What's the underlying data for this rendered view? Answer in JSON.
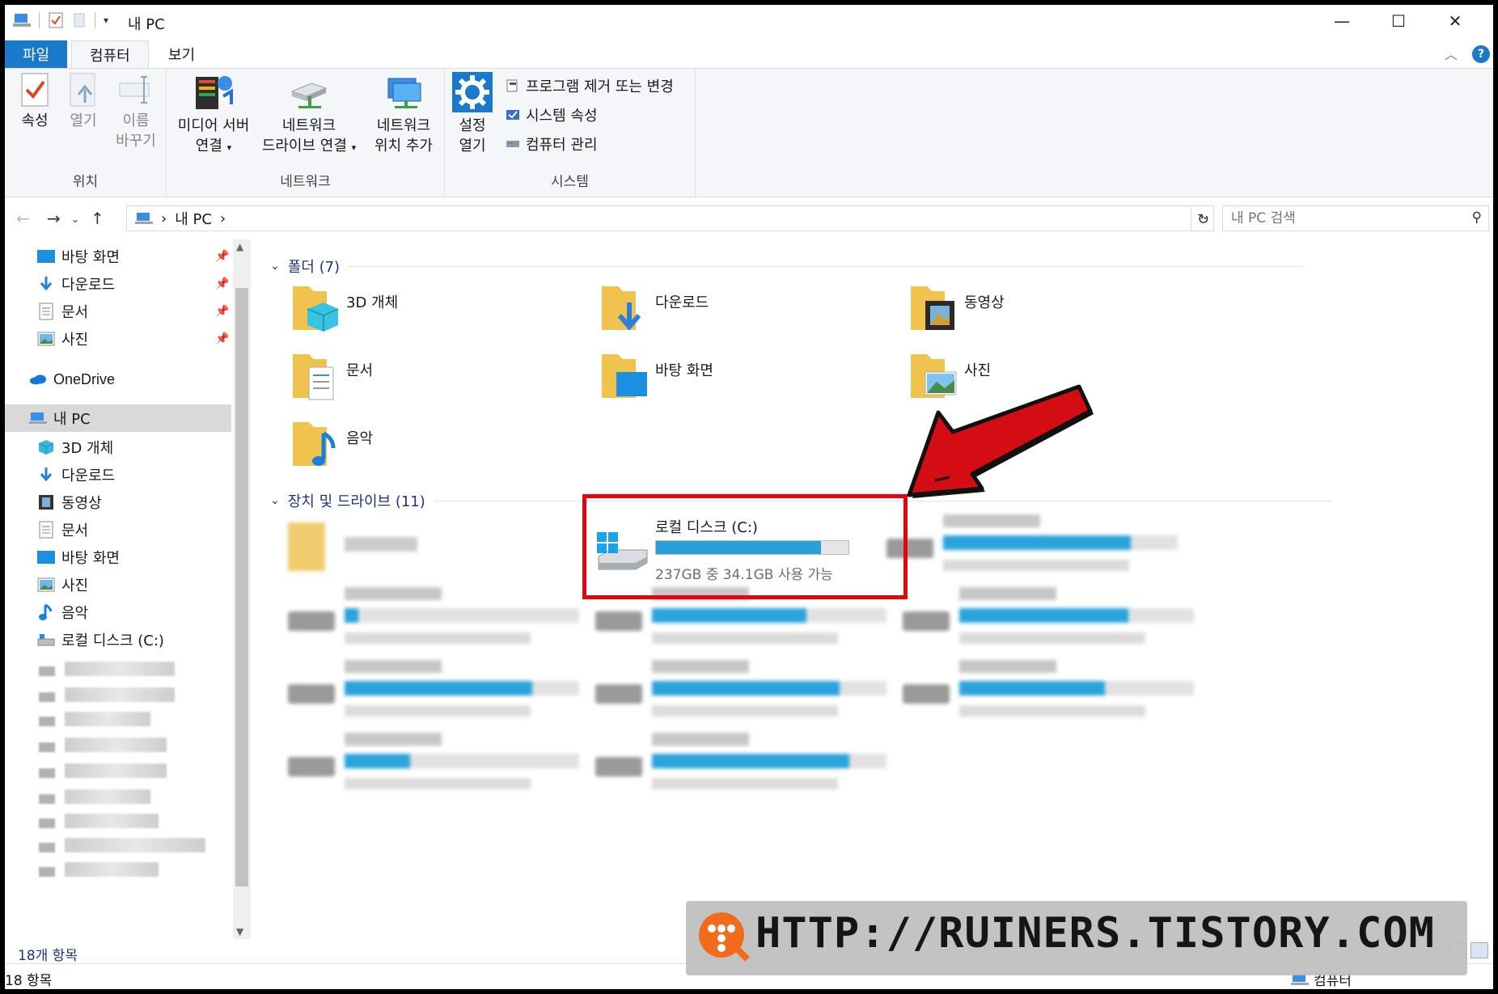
{
  "window": {
    "title": "내 PC",
    "minimize": "—",
    "maximize": "☐",
    "close": "✕"
  },
  "tabs": {
    "file": "파일",
    "computer": "컴퓨터",
    "view": "보기"
  },
  "ribbon": {
    "location": {
      "label": "위치",
      "properties": "속성",
      "open": "열기",
      "rename_1": "이름",
      "rename_2": "바꾸기"
    },
    "network": {
      "label": "네트워크",
      "media_1": "미디어 서버",
      "media_2": "연결",
      "map_1": "네트워크",
      "map_2": "드라이브 연결",
      "add_1": "네트워크",
      "add_2": "위치 추가"
    },
    "system": {
      "label": "시스템",
      "settings_1": "설정",
      "settings_2": "열기",
      "uninstall": "프로그램 제거 또는 변경",
      "sys_props": "시스템 속성",
      "manage": "컴퓨터 관리"
    }
  },
  "address": {
    "path": "내 PC",
    "search_placeholder": "내 PC 검색"
  },
  "sidebar": {
    "quick": [
      {
        "label": "바탕 화면"
      },
      {
        "label": "다운로드"
      },
      {
        "label": "문서"
      },
      {
        "label": "사진"
      }
    ],
    "onedrive": "OneDrive",
    "thispc": "내 PC",
    "pc_items": [
      {
        "label": "3D 개체"
      },
      {
        "label": "다운로드"
      },
      {
        "label": "동영상"
      },
      {
        "label": "문서"
      },
      {
        "label": "바탕 화면"
      },
      {
        "label": "사진"
      },
      {
        "label": "음악"
      },
      {
        "label": "로컬 디스크 (C:)"
      }
    ]
  },
  "content": {
    "folders_header": "폴더 (7)",
    "folders": [
      {
        "name": "3D 개체"
      },
      {
        "name": "다운로드"
      },
      {
        "name": "동영상"
      },
      {
        "name": "문서"
      },
      {
        "name": "바탕 화면"
      },
      {
        "name": "사진"
      },
      {
        "name": "음악"
      }
    ],
    "drives_header": "장치 및 드라이브 (11)",
    "local_disk": {
      "name": "로컬 디스크 (C:)",
      "capacity": "237GB 중 34.1GB 사용 가능",
      "used_fraction": 0.856
    }
  },
  "status": {
    "count": "18개 항목"
  },
  "bottombar": {
    "left": "18 항목",
    "right": "컴퓨터"
  },
  "watermark": {
    "text": "HTTP://RUINERS.TISTORY.COM"
  },
  "colors": {
    "accent": "#1979ca",
    "progress": "#26a0da",
    "highlight": "#e3060e",
    "arrow": "#d40d14",
    "folder": "#f0c24e"
  }
}
